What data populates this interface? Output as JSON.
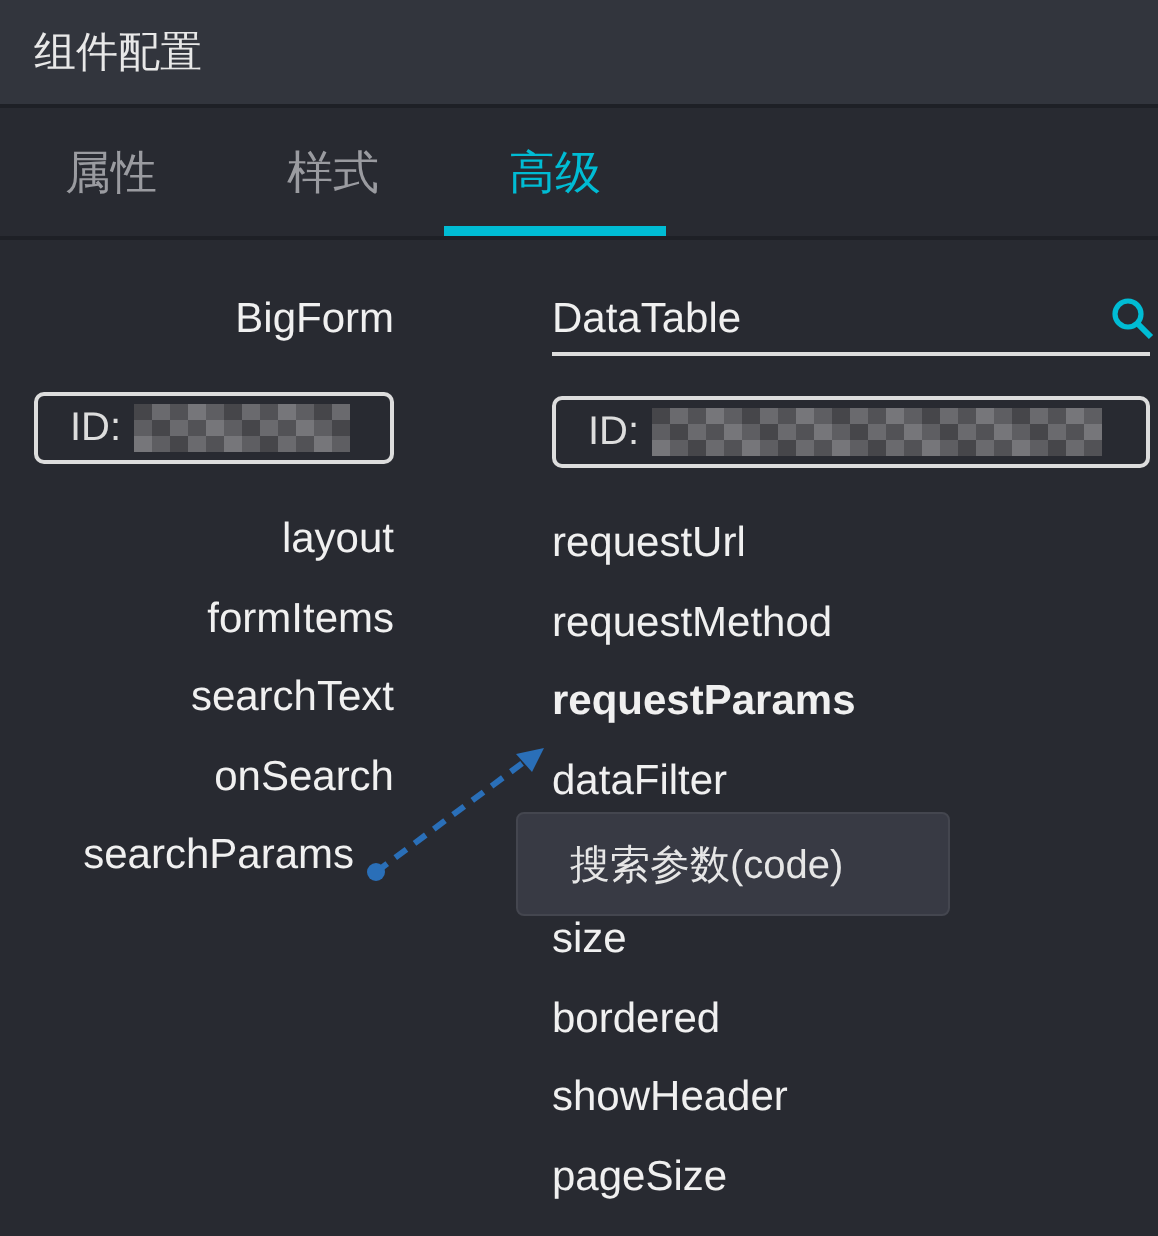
{
  "window": {
    "title": "组件配置"
  },
  "tabs": [
    {
      "label": "属性",
      "selected": false
    },
    {
      "label": "样式",
      "selected": false
    },
    {
      "label": "高级",
      "selected": true
    }
  ],
  "source": {
    "name": "BigForm",
    "id_label": "ID:",
    "fields": [
      {
        "label": "layout"
      },
      {
        "label": "formItems"
      },
      {
        "label": "searchText"
      },
      {
        "label": "onSearch"
      },
      {
        "label": "searchParams",
        "linked": true
      }
    ]
  },
  "target": {
    "search": {
      "value": "DataTable"
    },
    "id_label": "ID:",
    "fields": [
      {
        "label": "requestUrl",
        "linked": false
      },
      {
        "label": "requestMethod",
        "linked": false
      },
      {
        "label": "requestParams",
        "linked": true
      },
      {
        "label": "dataFilter",
        "linked": false
      },
      {
        "label": "size",
        "linked": false
      },
      {
        "label": "bordered",
        "linked": false
      },
      {
        "label": "showHeader",
        "linked": false
      },
      {
        "label": "pageSize",
        "linked": false
      }
    ]
  },
  "tooltip": {
    "text": "搜索参数(code)"
  }
}
